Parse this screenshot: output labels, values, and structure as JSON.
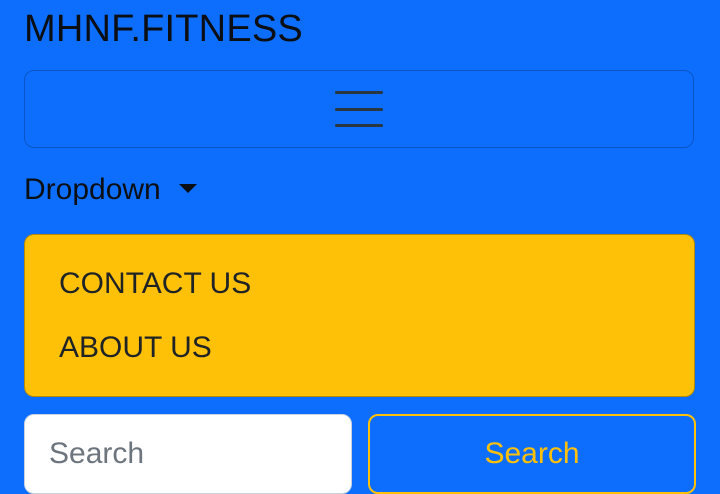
{
  "navbar": {
    "brand": "MHNF.FITNESS",
    "toggler_icon": "hamburger-menu-icon",
    "dropdown_label": "Dropdown",
    "dropdown_icon": "caret-down-icon"
  },
  "menu": {
    "items": [
      {
        "label": "CONTACT US"
      },
      {
        "label": "ABOUT US"
      }
    ]
  },
  "search": {
    "placeholder": "Search",
    "value": "",
    "button_label": "Search"
  },
  "colors": {
    "background": "#0d6efd",
    "menu_background": "#ffc107",
    "button_outline": "#ffc107"
  }
}
